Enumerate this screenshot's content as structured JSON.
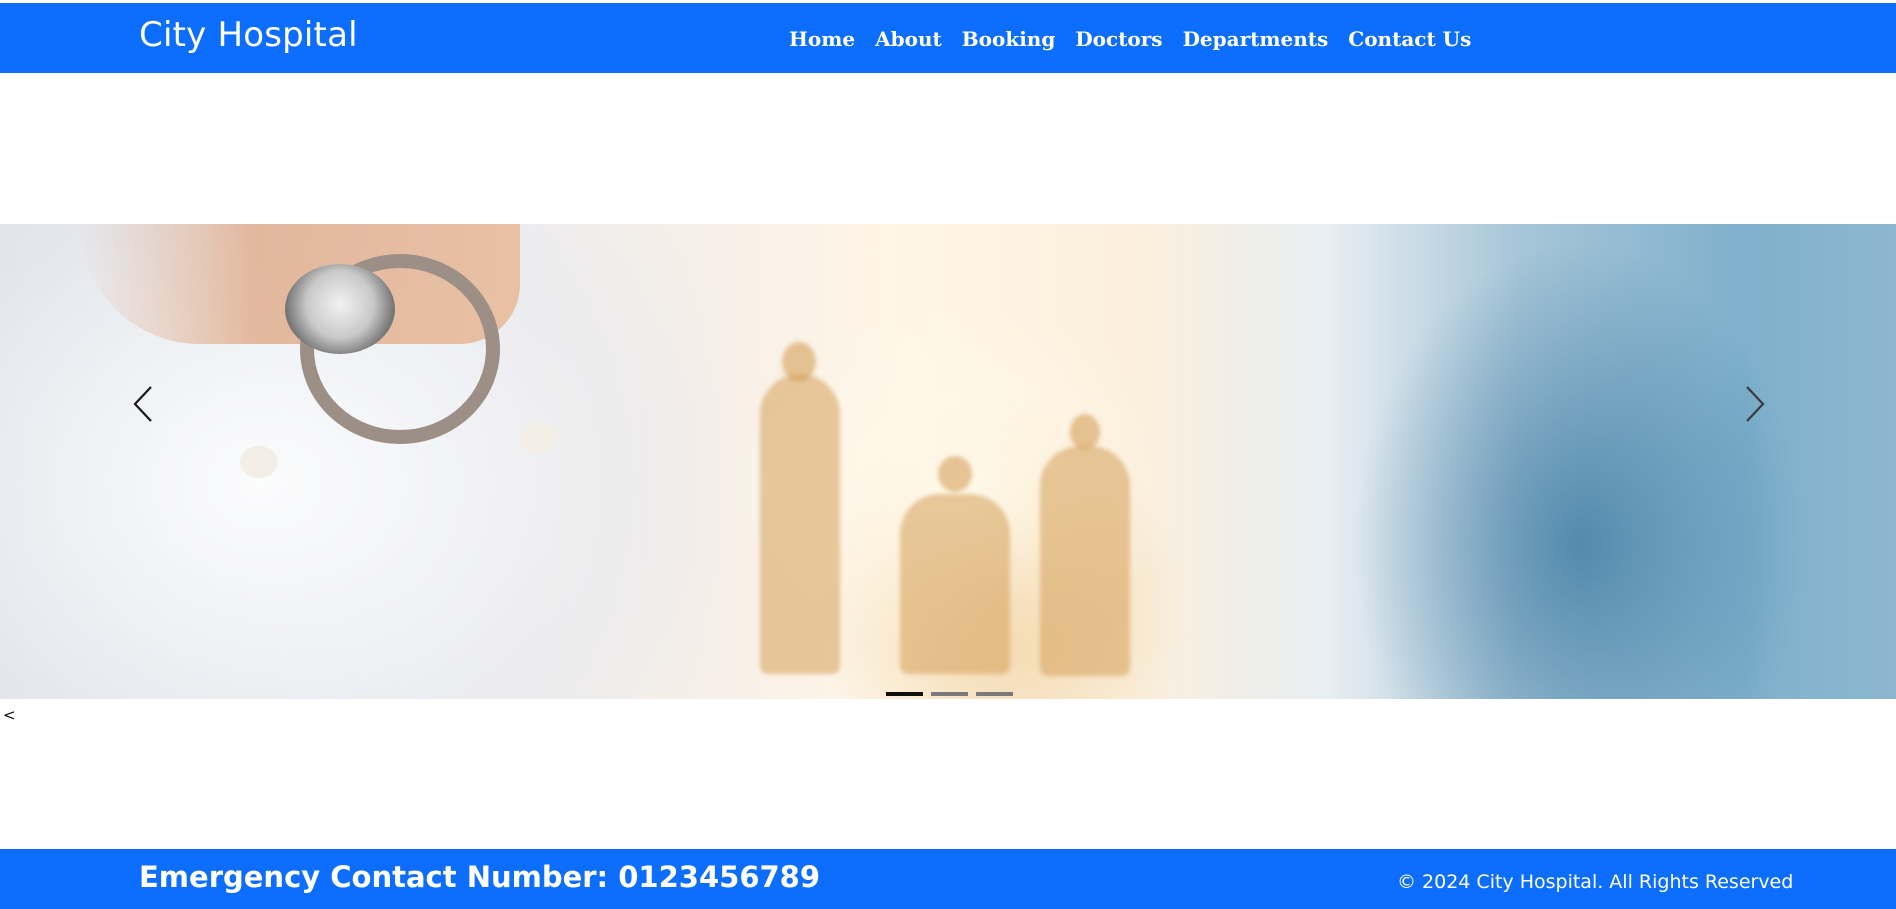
{
  "header": {
    "brand": "City Hospital",
    "nav": [
      "Home",
      "About",
      "Booking",
      "Doctors",
      "Departments",
      "Contact Us"
    ]
  },
  "carousel": {
    "prev_icon": "chevron-left-icon",
    "next_icon": "chevron-right-icon",
    "slide_count": 3,
    "active_slide": 1
  },
  "stray_text": "<",
  "footer": {
    "emergency": "Emergency Contact Number: 0123456789",
    "copyright": "© 2024 City Hospital. All Rights Reserved"
  },
  "colors": {
    "primary": "#0d6efd",
    "text_on_primary": "#ffffff"
  }
}
